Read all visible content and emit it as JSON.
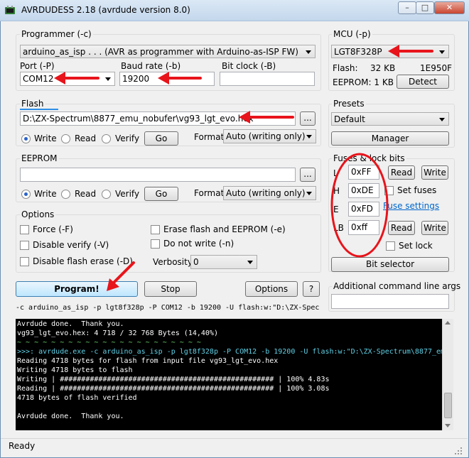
{
  "window": {
    "title": "AVRDUDESS 2.18 (avrdude version 8.0)",
    "min": "–",
    "max": "□",
    "close": "✕"
  },
  "programmer": {
    "group_label": "Programmer (-c)",
    "value": "arduino_as_isp . . . (AVR as programmer with Arduino-as-ISP FW)",
    "port_label": "Port (-P)",
    "port_value": "COM12",
    "baud_label": "Baud rate (-b)",
    "baud_value": "19200",
    "bitclock_label": "Bit clock (-B)",
    "bitclock_value": ""
  },
  "mcu": {
    "group_label": "MCU (-p)",
    "value": "LGT8F328P",
    "flash_label": "Flash:",
    "flash_size": "32 KB",
    "flash_sig": "1E950F",
    "eeprom_label": "EEPROM: 1 KB",
    "detect_label": "Detect"
  },
  "flash": {
    "group_label": "Flash",
    "file": "D:\\ZX-Spectrum\\8877_emu_nobufer\\vg93_lgt_evo.hex",
    "browse": "...",
    "write": "Write",
    "read": "Read",
    "verify": "Verify",
    "selected": "write",
    "go": "Go",
    "format_label": "Format",
    "format_value": "Auto (writing only)"
  },
  "presets": {
    "group_label": "Presets",
    "value": "Default",
    "manager": "Manager"
  },
  "eeprom": {
    "group_label": "EEPROM",
    "file": "",
    "browse": "...",
    "write": "Write",
    "read": "Read",
    "verify": "Verify",
    "selected": "write",
    "go": "Go",
    "format_label": "Format",
    "format_value": "Auto (writing only)"
  },
  "fuses": {
    "group_label": "Fuses & lock bits",
    "l_label": "L",
    "l_value": "0xFF",
    "h_label": "H",
    "h_value": "0xDE",
    "e_label": "E",
    "e_value": "0xFD",
    "lb_label": "LB",
    "lb_value": "0xff",
    "read": "Read",
    "write": "Write",
    "set_fuses": "Set fuses",
    "fuse_settings_link": "Fuse settings",
    "set_lock": "Set lock",
    "bit_selector": "Bit selector"
  },
  "options": {
    "group_label": "Options",
    "force": "Force (-F)",
    "disable_verify": "Disable verify (-V)",
    "disable_flash_erase": "Disable flash erase (-D)",
    "erase_flash": "Erase flash and EEPROM (-e)",
    "do_not_write": "Do not write (-n)",
    "verbosity_label": "Verbosity",
    "verbosity_value": "0"
  },
  "actions": {
    "program": "Program!",
    "stop": "Stop",
    "options": "Options",
    "help": "?"
  },
  "additional_args": {
    "label": "Additional command line args",
    "value": ""
  },
  "command_line": "-c arduino_as_isp -p lgt8f328p -P COM12 -b 19200 -U flash:w:\"D:\\ZX-Spec",
  "console": {
    "lines": [
      {
        "text": "Avrdude done.  Thank you.",
        "cls": "w"
      },
      {
        "text": "vg93_lgt_evo.hex: 4 718 / 32 768 Bytes (14,40%)",
        "cls": "w"
      },
      {
        "text": "~ ~ ~ ~ ~ ~ ~ ~ ~ ~ ~ ~ ~ ~ ~ ~ ~ ~ ~ ~ ~ ~",
        "cls": "g"
      },
      {
        "text": ">>>: avrdude.exe -c arduino_as_isp -p lgt8f328p -P COM12 -b 19200 -U flash:w:\"D:\\ZX-Spectrum\\8877_em",
        "cls": "c"
      },
      {
        "text": "Reading 4718 bytes for flash from input file vg93_lgt_evo.hex",
        "cls": "w"
      },
      {
        "text": "Writing 4718 bytes to flash",
        "cls": "w"
      },
      {
        "text": "Writing | ################################################## | 100% 4.83s",
        "cls": "w"
      },
      {
        "text": "Reading | ################################################## | 100% 3.08s",
        "cls": "w"
      },
      {
        "text": "4718 bytes of flash verified",
        "cls": "w"
      },
      {
        "text": "",
        "cls": "w"
      },
      {
        "text": "Avrdude done.  Thank you.",
        "cls": "w"
      }
    ]
  },
  "status": {
    "text": "Ready"
  },
  "colors": {
    "annotation_red": "#e8141b",
    "accent": "#2a62c9"
  }
}
